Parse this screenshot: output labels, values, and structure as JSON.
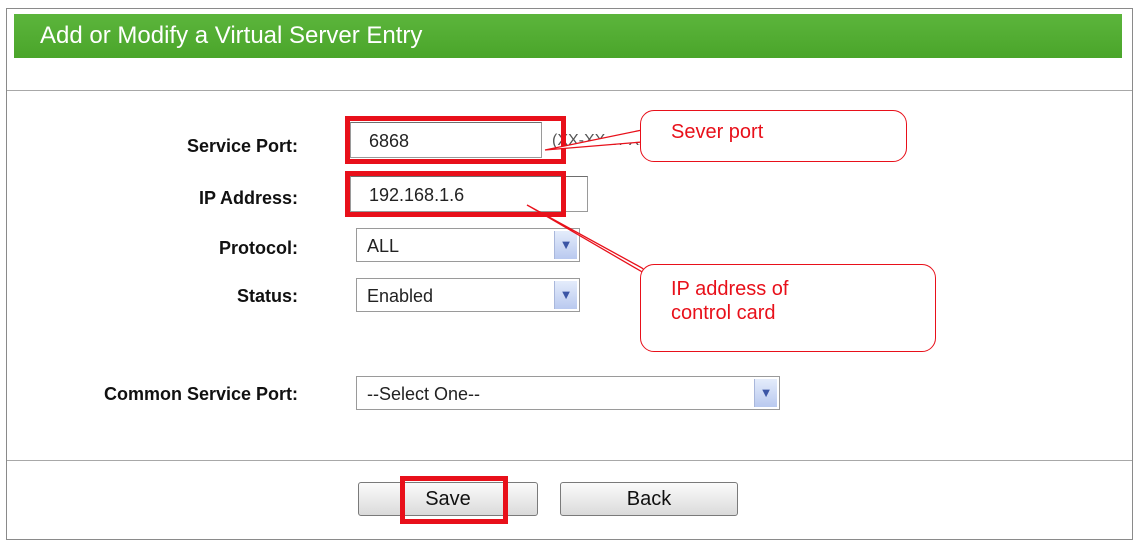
{
  "header": {
    "title": "Add or Modify a Virtual Server Entry"
  },
  "form": {
    "service_port": {
      "label": "Service Port:",
      "value": "6868",
      "hint": "(XX-XX or XX)"
    },
    "ip_address": {
      "label": "IP Address:",
      "value": "192.168.1.6"
    },
    "protocol": {
      "label": "Protocol:",
      "value": "ALL"
    },
    "status": {
      "label": "Status:",
      "value": "Enabled"
    },
    "common_service_port": {
      "label": "Common Service Port:",
      "value": "--Select One--"
    }
  },
  "buttons": {
    "save": "Save",
    "back": "Back"
  },
  "annotations": {
    "server_port_callout": "Sever port",
    "ip_callout_line1": "IP address of",
    "ip_callout_line2": "control card"
  },
  "colors": {
    "header_green": "#4fab30",
    "highlight_red": "#e8101a"
  }
}
